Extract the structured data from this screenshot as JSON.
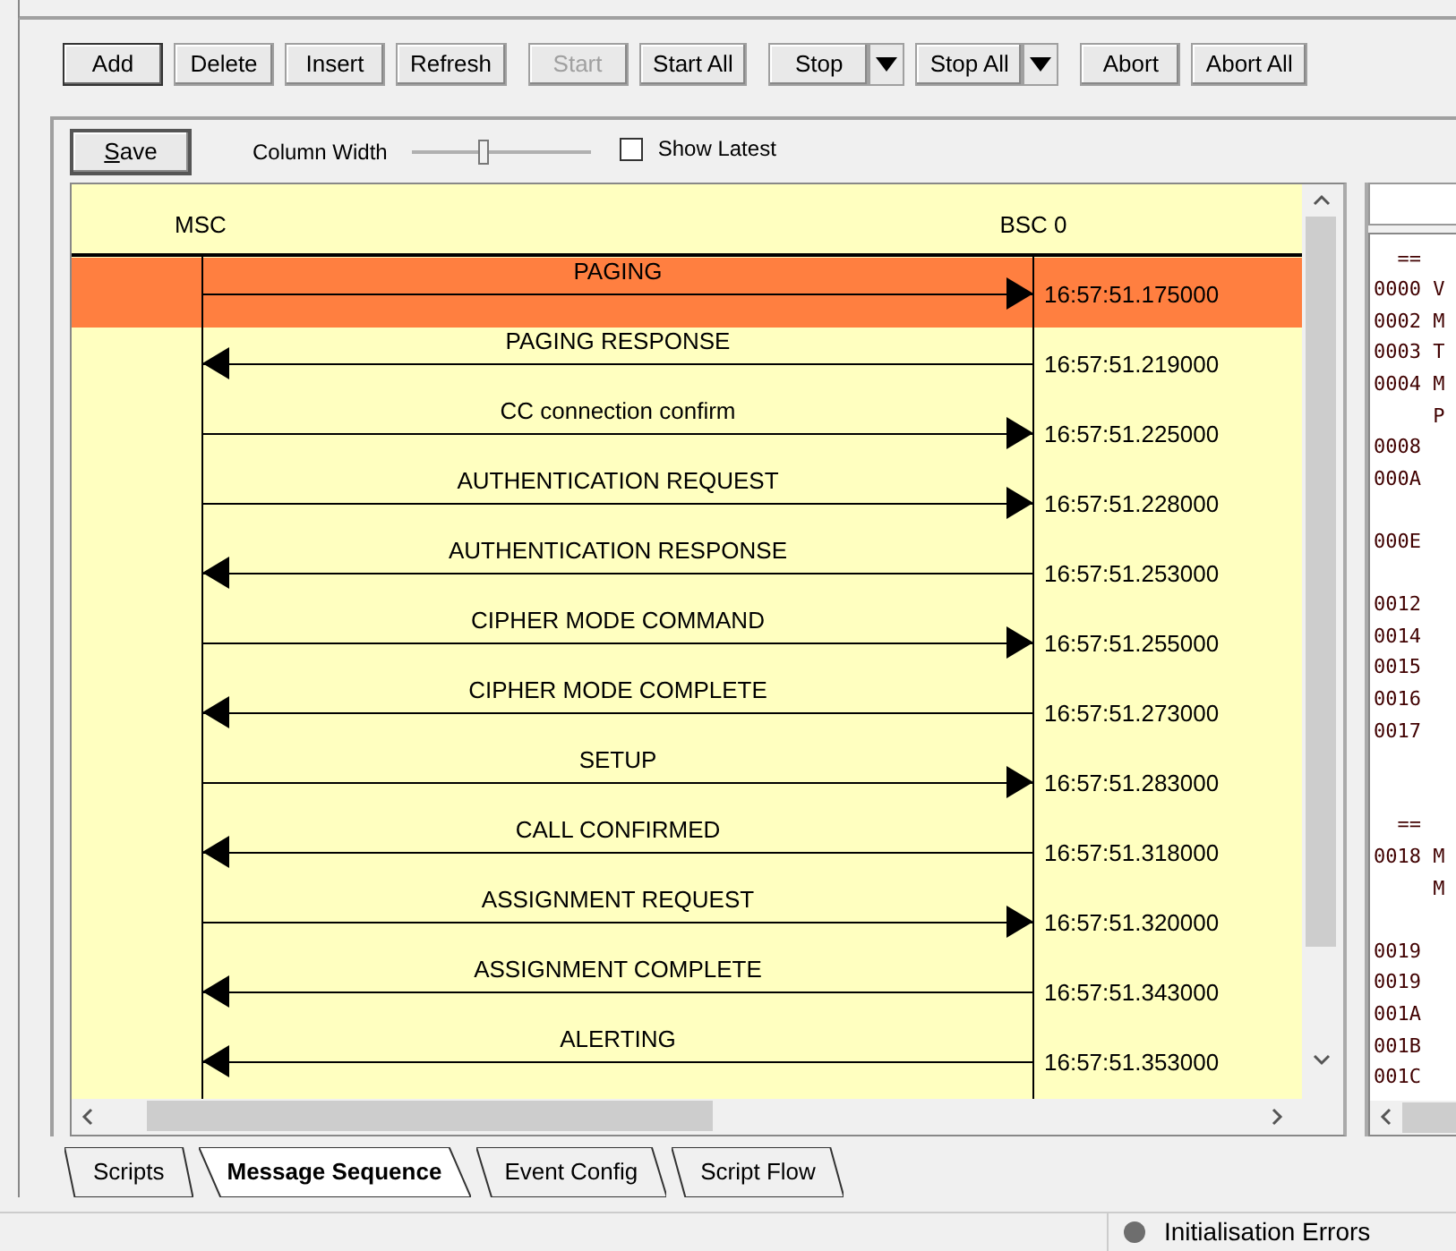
{
  "toolbar": {
    "groups": [
      [
        {
          "label": "Add",
          "kind": "plain",
          "disabled": false,
          "focused": true
        },
        {
          "label": "Delete",
          "kind": "plain",
          "disabled": false,
          "focused": false
        },
        {
          "label": "Insert",
          "kind": "plain",
          "disabled": false,
          "focused": false
        },
        {
          "label": "Refresh",
          "kind": "plain",
          "disabled": false,
          "focused": false
        }
      ],
      [
        {
          "label": "Start",
          "kind": "plain",
          "disabled": true,
          "focused": false
        },
        {
          "label": "Start All",
          "kind": "plain",
          "disabled": false,
          "focused": false
        }
      ],
      [
        {
          "label": "Stop",
          "kind": "split",
          "disabled": false,
          "focused": false
        },
        {
          "label": "Stop All",
          "kind": "split",
          "disabled": false,
          "focused": false
        }
      ],
      [
        {
          "label": "Abort",
          "kind": "plain",
          "disabled": false,
          "focused": false
        },
        {
          "label": "Abort All",
          "kind": "plain",
          "disabled": false,
          "focused": false
        }
      ]
    ]
  },
  "options": {
    "save": {
      "label": "Save"
    },
    "column_width": {
      "label": "Column Width",
      "level": 0.4
    },
    "show_latest": {
      "label": "Show Latest",
      "checked": false
    }
  },
  "sequence": {
    "left_entity": "MSC",
    "right_entity": "BSC 0",
    "messages": [
      {
        "label": "PAGING",
        "time": "16:57:51.175000",
        "kind": "rightward",
        "selected": true
      },
      {
        "label": "PAGING RESPONSE",
        "time": "16:57:51.219000",
        "kind": "leftward",
        "selected": false
      },
      {
        "label": "CC connection confirm",
        "time": "16:57:51.225000",
        "kind": "rightward",
        "selected": false
      },
      {
        "label": "AUTHENTICATION REQUEST",
        "time": "16:57:51.228000",
        "kind": "rightward",
        "selected": false
      },
      {
        "label": "AUTHENTICATION RESPONSE",
        "time": "16:57:51.253000",
        "kind": "leftward",
        "selected": false
      },
      {
        "label": "CIPHER MODE COMMAND",
        "time": "16:57:51.255000",
        "kind": "rightward",
        "selected": false
      },
      {
        "label": "CIPHER MODE COMPLETE",
        "time": "16:57:51.273000",
        "kind": "leftward",
        "selected": false
      },
      {
        "label": "SETUP",
        "time": "16:57:51.283000",
        "kind": "rightward",
        "selected": false
      },
      {
        "label": "CALL CONFIRMED",
        "time": "16:57:51.318000",
        "kind": "leftward",
        "selected": false
      },
      {
        "label": "ASSIGNMENT REQUEST",
        "time": "16:57:51.320000",
        "kind": "rightward",
        "selected": false
      },
      {
        "label": "ASSIGNMENT COMPLETE",
        "time": "16:57:51.343000",
        "kind": "leftward",
        "selected": false
      },
      {
        "label": "ALERTING",
        "time": "16:57:51.353000",
        "kind": "leftward",
        "selected": false
      }
    ]
  },
  "hex_dump": {
    "lines": [
      {
        "kind": "text",
        "text": "  =="
      },
      {
        "kind": "text",
        "text": "0000 V"
      },
      {
        "kind": "text",
        "text": "0002 M"
      },
      {
        "kind": "text",
        "text": "0003 T"
      },
      {
        "kind": "text",
        "text": "0004 M"
      },
      {
        "kind": "text",
        "text": "     P"
      },
      {
        "kind": "text",
        "text": "0008"
      },
      {
        "kind": "text",
        "text": "000A"
      },
      {
        "kind": "gap"
      },
      {
        "kind": "text",
        "text": "000E"
      },
      {
        "kind": "gap"
      },
      {
        "kind": "text",
        "text": "0012"
      },
      {
        "kind": "text",
        "text": "0014"
      },
      {
        "kind": "text",
        "text": "0015"
      },
      {
        "kind": "text",
        "text": "0016"
      },
      {
        "kind": "text",
        "text": "0017"
      },
      {
        "kind": "gap"
      },
      {
        "kind": "gap"
      },
      {
        "kind": "text",
        "text": "  =="
      },
      {
        "kind": "text",
        "text": "0018 M"
      },
      {
        "kind": "text",
        "text": "     M"
      },
      {
        "kind": "gap"
      },
      {
        "kind": "text",
        "text": "0019"
      },
      {
        "kind": "text",
        "text": "0019"
      },
      {
        "kind": "text",
        "text": "001A"
      },
      {
        "kind": "text",
        "text": "001B"
      },
      {
        "kind": "text",
        "text": "001C"
      }
    ]
  },
  "tabs": [
    {
      "label": "Scripts",
      "selected": false
    },
    {
      "label": "Message Sequence",
      "selected": true
    },
    {
      "label": "Event Config",
      "selected": false
    },
    {
      "label": "Script Flow",
      "selected": false
    }
  ],
  "status_bar": {
    "errors": "Initialisation Errors"
  }
}
